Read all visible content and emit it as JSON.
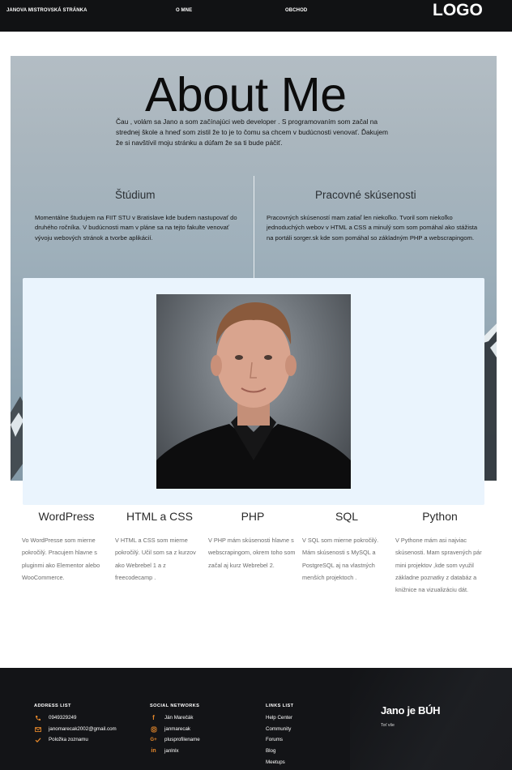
{
  "nav": {
    "site_title": "JANOVA MISTROVSKÁ STRÁNKA",
    "about_link": "O MNE",
    "shop_link": "OBCHOD",
    "logo": "LOGO"
  },
  "hero": {
    "title": "About Me",
    "intro": "Čau , volám sa Jano a som začínajúci web developer . S programovaním som začal na strednej škole  a hneď som zistil že to je to čomu sa chcem v budúcnosti venovať. Ďakujem že si navštívil moju stránku a dúfam že sa ti bude páčiť.",
    "study_title": "Štúdium",
    "study_text": "Momentálne študujem na FIIT STU v Bratislave kde budem nastupovať do druhého ročníka. V budúcnosti mam v pláne sa na tejto fakulte venovať vývoju webových stránok a tvorbe aplikácií.",
    "work_title": "Pracovné skúsenosti",
    "work_text": "Pracovných skúseností mam zatiaľ len niekoľko. Tvoril som niekoľko jednoduchých webov v HTML a CSS a minulý som som pomáhal ako stážista na portáli sorger.sk kde som pomáhal so základným PHP a webscrapingom."
  },
  "skills": [
    {
      "title": "WordPress",
      "text": "Vo WordPresse som mierne pokročilý. Pracujem hlavne s pluginmi ako Elementor alebo WooCommerce."
    },
    {
      "title": "HTML a CSS",
      "text": "V HTML a CSS som mierne pokročilý. Učil som sa z kurzov ako Webrebel 1 a z freecodecamp ."
    },
    {
      "title": "PHP",
      "text": "V PHP mám skúsenosti hlavne s webscrapingom, okrem toho som začal aj kurz Webrebel 2."
    },
    {
      "title": "SQL",
      "text": "V SQL som mierne pokročilý. Mám skúsenosti s MySQL a PostgreSQL aj na vlastných menších projektoch ."
    },
    {
      "title": "Python",
      "text": "V Pythone mám asi najviac skúsenosti. Mam spravených pár mini projektov ,kde som využil základne poznatky z databáz a knižnice na vizualizáciu dát."
    }
  ],
  "footer": {
    "address": {
      "heading": "ADDRESS LIST",
      "items": [
        {
          "icon": "phone-icon",
          "text": "0949329249"
        },
        {
          "icon": "envelope-icon",
          "text": "janomarecak2002@gmail.com"
        },
        {
          "icon": "check-icon",
          "text": "Položka zoznamu"
        }
      ]
    },
    "social": {
      "heading": "SOCIAL NETWORKS",
      "items": [
        {
          "icon": "facebook-icon",
          "text": "Ján Marečák"
        },
        {
          "icon": "instagram-icon",
          "text": "janmarecak"
        },
        {
          "icon": "google-plus-icon",
          "text": "plusprofilename"
        },
        {
          "icon": "linkedin-icon",
          "text": "janlnlx"
        }
      ]
    },
    "links": {
      "heading": "LINKS LIST",
      "items": [
        "Help Center",
        "Community",
        "Forums",
        "Blog",
        "Meetups"
      ]
    },
    "brand": "Jano je BÚH",
    "brand_sub": "Toť vše"
  },
  "colors": {
    "nav_bg": "#111214",
    "footer_bg": "#131417",
    "panel_bg": "#eaf4fd",
    "icon_accent": "#e7892b"
  }
}
